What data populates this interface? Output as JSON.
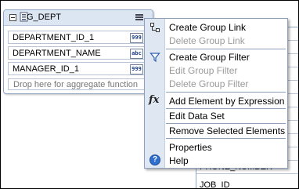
{
  "dataset": {
    "title": "G_DEPT",
    "fields": [
      {
        "name": "DEPARTMENT_ID_1",
        "type": "999"
      },
      {
        "name": "DEPARTMENT_NAME",
        "type": "abc"
      },
      {
        "name": "MANAGER_ID_1",
        "type": "999"
      }
    ],
    "drop_zone": "Drop here for aggregate function"
  },
  "background_table": {
    "rows": [
      "PHONE_NUMBER",
      "JOB_ID"
    ]
  },
  "context_menu": {
    "items": [
      {
        "label": "Create Group Link",
        "enabled": true,
        "icon": "group-link-icon"
      },
      {
        "label": "Delete Group Link",
        "enabled": false
      },
      {
        "label": "Create Group Filter",
        "enabled": true,
        "icon": "filter-icon"
      },
      {
        "label": "Edit Group Filter",
        "enabled": false
      },
      {
        "label": "Delete Group Filter",
        "enabled": false
      },
      {
        "label": "Add Element by Expression",
        "enabled": true,
        "icon": "fx-icon",
        "icon_text": "fx"
      },
      {
        "label": "Edit Data Set",
        "enabled": true
      },
      {
        "label": "Remove Selected Elements",
        "enabled": true
      },
      {
        "label": "Properties",
        "enabled": true
      },
      {
        "label": "Help",
        "enabled": true,
        "icon": "help-icon",
        "icon_text": "?"
      }
    ]
  },
  "colors": {
    "header_bg": "#dce6f3",
    "menu_gutter": "#dfe7f2",
    "border": "#8fa6c7",
    "disabled_text": "#9a9a9a"
  }
}
